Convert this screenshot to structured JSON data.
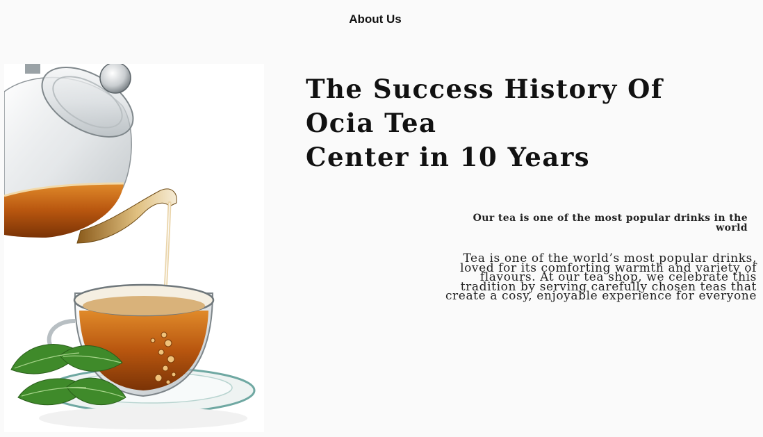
{
  "nav": {
    "title": "About Us"
  },
  "hero": {
    "headline_line1": "The Success History Of Ocia Tea",
    "headline_line2": "Center in 10 Years",
    "subheading": "Our tea is one of the most popular drinks in the world",
    "body": "Tea is one of the world’s most popular drinks, loved for its comforting warmth and variety of flavours. At our tea shop, we celebrate this tradition by serving carefully chosen teas that create a cosy, enjoyable experience for everyone",
    "image_icon": "teapot-pouring-tea-image"
  },
  "colors": {
    "background": "#fafafa",
    "text": "#111111",
    "tea": "#c46a17",
    "leaf": "#3f8a2a"
  }
}
